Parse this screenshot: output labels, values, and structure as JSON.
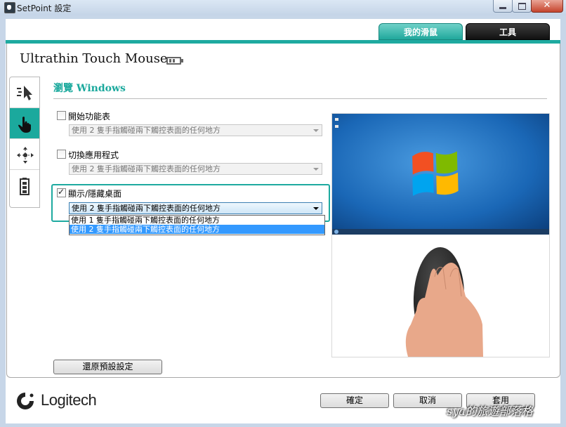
{
  "window": {
    "title": "SetPoint 設定",
    "close_glyph": "✕"
  },
  "tabs": [
    {
      "label": "我的滑鼠",
      "active": true
    },
    {
      "label": "工具",
      "active": false
    }
  ],
  "device": {
    "name": "Ultrathin Touch Mouse",
    "battery_icon": "battery-icon"
  },
  "sidebar": {
    "items": [
      {
        "name": "pointer-settings",
        "icon": "cursor-icon",
        "active": false
      },
      {
        "name": "gestures",
        "icon": "hand-icon",
        "active": true
      },
      {
        "name": "scrolling",
        "icon": "move-arrows-icon",
        "active": false
      },
      {
        "name": "battery",
        "icon": "battery-icon",
        "active": false
      }
    ]
  },
  "section": {
    "title": "瀏覽 Windows"
  },
  "options": [
    {
      "label": "開始功能表",
      "checked": false,
      "combo_value": "使用 2 隻手指觸碰兩下觸控表面的任何地方"
    },
    {
      "label": "切換應用程式",
      "checked": false,
      "combo_value": "使用 2 隻手指觸碰兩下觸控表面的任何地方"
    },
    {
      "label": "顯示/隱藏桌面",
      "checked": true,
      "combo_value": "使用 2 隻手指觸碰兩下觸控表面的任何地方"
    }
  ],
  "dropdown": {
    "items": [
      {
        "label": "使用 1 隻手指觸碰兩下觸控表面的任何地方",
        "selected": false
      },
      {
        "label": "使用 2 隻手指觸碰兩下觸控表面的任何地方",
        "selected": true
      }
    ]
  },
  "buttons": {
    "restore": "還原預設設定",
    "ok": "確定",
    "cancel": "取消",
    "apply": "套用"
  },
  "brand": {
    "logo_text": "Logitech"
  },
  "watermark": "sya的旅遊部落格",
  "colors": {
    "accent": "#1ba99d",
    "selected": "#3399ff",
    "win_blue": "#1a67b6"
  }
}
